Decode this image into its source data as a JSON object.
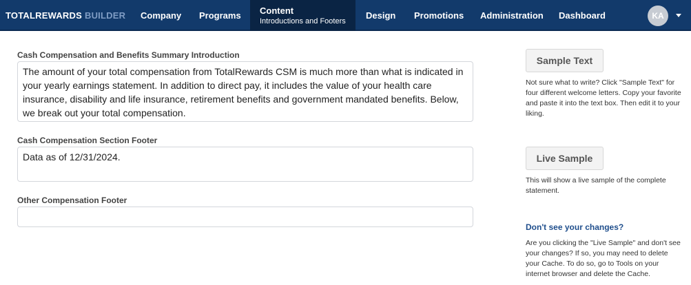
{
  "brand": {
    "part1": "TOTALREWARDS",
    "part2": "BUILDER"
  },
  "nav": {
    "company": "Company",
    "programs": "Programs",
    "content": "Content",
    "content_sub": "Introductions and Footers",
    "design": "Design",
    "promotions": "Promotions",
    "administration": "Administration",
    "dashboard": "Dashboard"
  },
  "user": {
    "initials": "KA"
  },
  "fields": {
    "intro_label": "Cash Compensation and Benefits Summary Introduction",
    "intro_value": "The amount of your total compensation from TotalRewards CSM is much more than what is indicated in your yearly earnings statement. In addition to direct pay, it includes the value of your health care insurance, disability and life insurance, retirement benefits and government mandated benefits. Below, we break out your total compensation.",
    "cash_footer_label": "Cash Compensation Section Footer",
    "cash_footer_value": "Data as of 12/31/2024.",
    "other_footer_label": "Other Compensation Footer",
    "other_footer_value": ""
  },
  "sidebar": {
    "sample_text_button": "Sample Text",
    "sample_text_help": "Not sure what to write? Click \"Sample Text\" for four different welcome letters. Copy your favorite and paste it into the text box. Then edit it to your liking.",
    "live_sample_button": "Live Sample",
    "live_sample_help": "This will show a live sample of the complete statement.",
    "changes_title": "Don't see your changes?",
    "changes_help": "Are you clicking the \"Live Sample\" and don't see your changes? If so, you may need to delete your Cache. To do so, go to Tools on your internet browser and delete the Cache."
  },
  "colors": {
    "header_bg": "#123a6b",
    "active_tab_bg": "#0a2444",
    "link_title": "#1f4e8c"
  }
}
